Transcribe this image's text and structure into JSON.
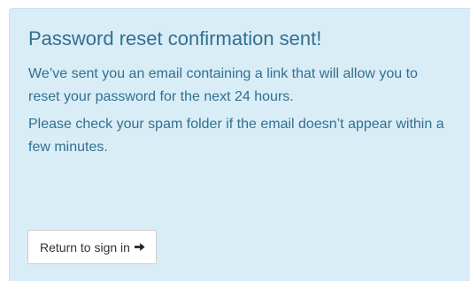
{
  "alert": {
    "title": "Password reset confirmation sent!",
    "message_1": "We’ve sent you an email containing a link that will allow you to reset your password for the next 24 hours.",
    "message_2": "Please check your spam folder if the email doesn’t appear within a few minutes."
  },
  "actions": {
    "return_label": "Return to sign in",
    "return_icon": "arrow-right-icon"
  },
  "colors": {
    "alert_background": "#d9edf7",
    "alert_text": "#31708f",
    "button_background": "#ffffff",
    "button_border": "#cccccc"
  }
}
